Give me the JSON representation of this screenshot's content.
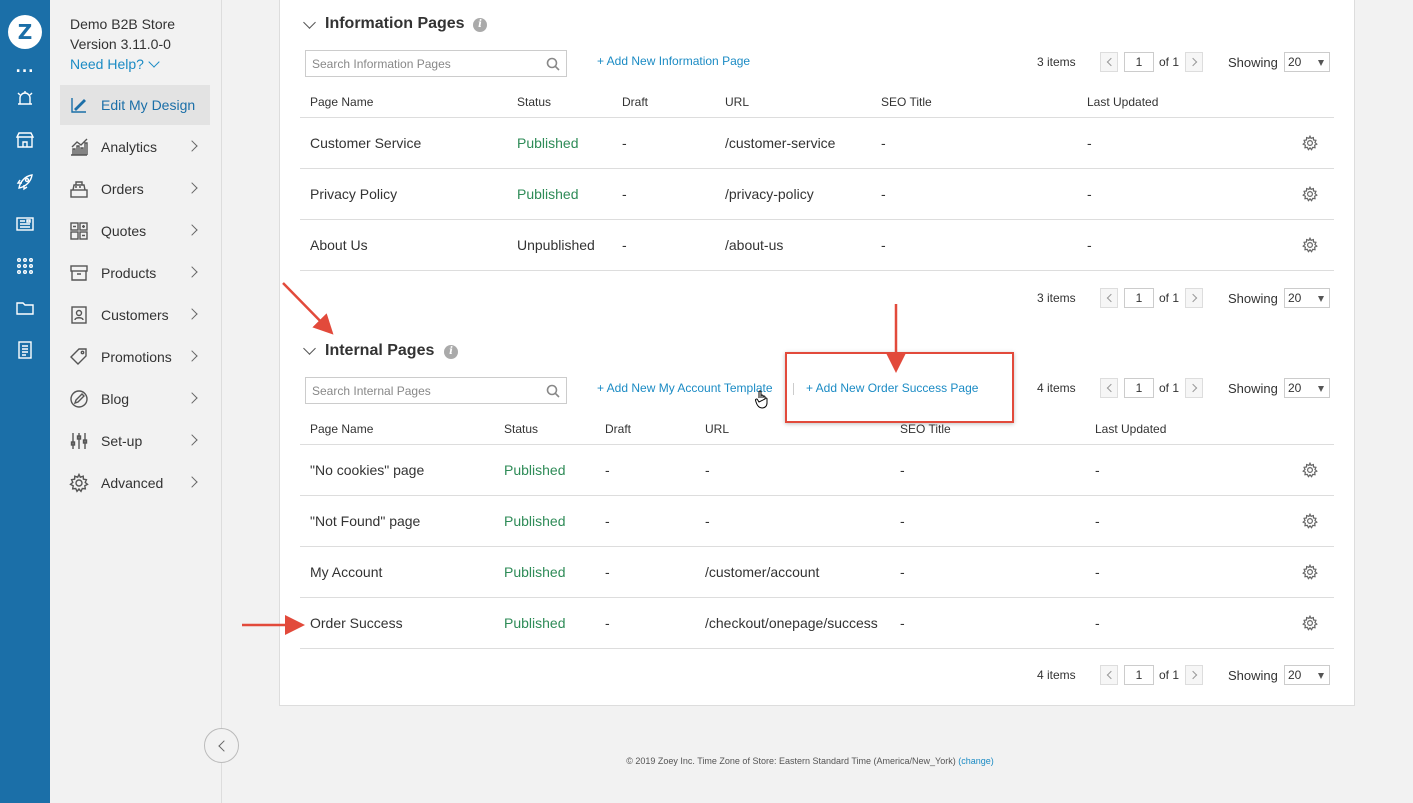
{
  "rail": {
    "logo": "Z",
    "dots": "..."
  },
  "sidebar": {
    "store_name": "Demo B2B Store",
    "version": "Version 3.11.0-0",
    "need_help": "Need Help?",
    "items": [
      {
        "label": "Edit My Design",
        "icon": "design-icon",
        "active": true
      },
      {
        "label": "Analytics",
        "icon": "chart-icon"
      },
      {
        "label": "Orders",
        "icon": "cash-register-icon"
      },
      {
        "label": "Quotes",
        "icon": "calculator-icon"
      },
      {
        "label": "Products",
        "icon": "box-icon"
      },
      {
        "label": "Customers",
        "icon": "contact-card-icon"
      },
      {
        "label": "Promotions",
        "icon": "tag-icon"
      },
      {
        "label": "Blog",
        "icon": "pen-icon"
      },
      {
        "label": "Set-up",
        "icon": "sliders-icon"
      },
      {
        "label": "Advanced",
        "icon": "gear-icon"
      }
    ]
  },
  "info_section": {
    "title": "Information Pages",
    "search_placeholder": "Search Information Pages",
    "add_link": "+ Add New Information Page",
    "pager": {
      "items": "3 items",
      "page": "1",
      "of": "of 1",
      "showing": "Showing",
      "per_page": "20"
    },
    "columns": [
      "Page Name",
      "Status",
      "Draft",
      "URL",
      "SEO Title",
      "Last Updated"
    ],
    "rows": [
      {
        "name": "Customer Service",
        "status": "Published",
        "draft": "-",
        "url": "/customer-service",
        "seo": "-",
        "updated": "-"
      },
      {
        "name": "Privacy Policy",
        "status": "Published",
        "draft": "-",
        "url": "/privacy-policy",
        "seo": "-",
        "updated": "-"
      },
      {
        "name": "About Us",
        "status": "Unpublished",
        "draft": "-",
        "url": "/about-us",
        "seo": "-",
        "updated": "-"
      }
    ],
    "pager_bottom": {
      "items": "3 items",
      "page": "1",
      "of": "of 1",
      "showing": "Showing",
      "per_page": "20"
    }
  },
  "internal_section": {
    "title": "Internal Pages",
    "search_placeholder": "Search Internal Pages",
    "add_link_1": "+ Add New My Account Template",
    "add_link_2": "+ Add New Order Success Page",
    "pager": {
      "items": "4 items",
      "page": "1",
      "of": "of 1",
      "showing": "Showing",
      "per_page": "20"
    },
    "columns": [
      "Page Name",
      "Status",
      "Draft",
      "URL",
      "SEO Title",
      "Last Updated"
    ],
    "rows": [
      {
        "name": "\"No cookies\" page",
        "status": "Published",
        "draft": "-",
        "url": "-",
        "seo": "-",
        "updated": "-"
      },
      {
        "name": "\"Not Found\" page",
        "status": "Published",
        "draft": "-",
        "url": "-",
        "seo": "-",
        "updated": "-"
      },
      {
        "name": "My Account",
        "status": "Published",
        "draft": "-",
        "url": "/customer/account",
        "seo": "-",
        "updated": "-"
      },
      {
        "name": "Order Success",
        "status": "Published",
        "draft": "-",
        "url": "/checkout/onepage/success",
        "seo": "-",
        "updated": "-"
      }
    ],
    "pager_bottom": {
      "items": "4 items",
      "page": "1",
      "of": "of 1",
      "showing": "Showing",
      "per_page": "20"
    }
  },
  "footer": {
    "text": "© 2019 Zoey Inc. Time Zone of Store: Eastern Standard Time (America/New_York)",
    "change": "(change)"
  },
  "colors": {
    "rail": "#1b6fa8",
    "link": "#1b8bc4",
    "published": "#2e8b57",
    "annotation": "#e24a3b"
  }
}
